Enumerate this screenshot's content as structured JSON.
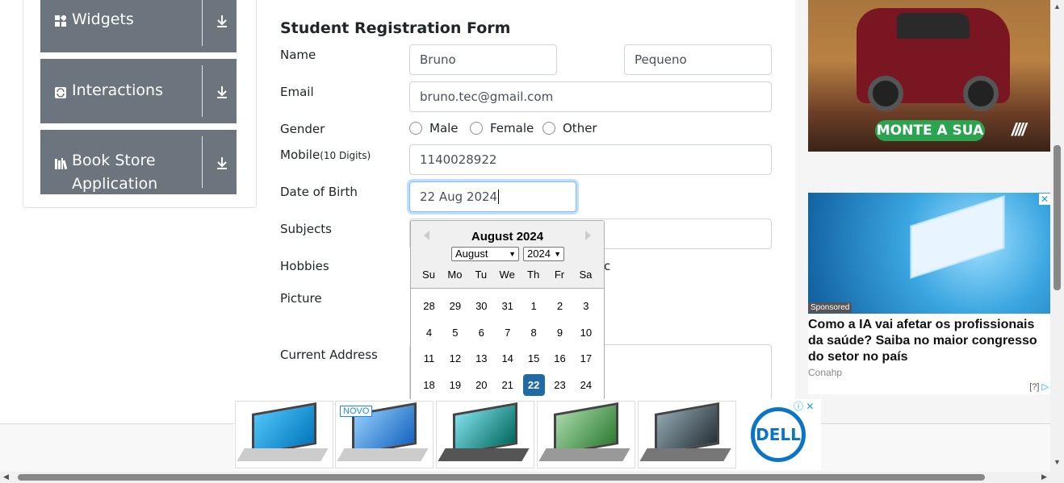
{
  "sidebar": {
    "groups": [
      {
        "label": "Widgets",
        "icon": "widgets-icon"
      },
      {
        "label": "Interactions",
        "icon": "interactions-icon"
      },
      {
        "label": "Book Store\nApplication",
        "label_line1": "Book Store",
        "label_line2": "Application",
        "icon": "books-icon"
      }
    ]
  },
  "form": {
    "title": "Student Registration Form",
    "name_label": "Name",
    "first_name": "Bruno",
    "last_name": "Pequeno",
    "email_label": "Email",
    "email": "bruno.tec@gmail.com",
    "gender_label": "Gender",
    "gender_options": [
      "Male",
      "Female",
      "Other"
    ],
    "mobile_label": "Mobile",
    "mobile_hint": "(10 Digits)",
    "mobile": "1140028922",
    "dob_label": "Date of Birth",
    "dob": "22 Aug 2024",
    "subjects_label": "Subjects",
    "hobbies_label": "Hobbies",
    "hobbies_tail": "c",
    "picture_label": "Picture",
    "address_label": "Current Address"
  },
  "datepicker": {
    "month_title": "August 2024",
    "month_select": "August",
    "year_select": "2024",
    "day_names": [
      "Su",
      "Mo",
      "Tu",
      "We",
      "Th",
      "Fr",
      "Sa"
    ],
    "weeks": [
      [
        "28",
        "29",
        "30",
        "31",
        "1",
        "2",
        "3"
      ],
      [
        "4",
        "5",
        "6",
        "7",
        "8",
        "9",
        "10"
      ],
      [
        "11",
        "12",
        "13",
        "14",
        "15",
        "16",
        "17"
      ],
      [
        "18",
        "19",
        "20",
        "21",
        "22",
        "23",
        "24"
      ]
    ],
    "selected": "22",
    "accent": "#216ba5"
  },
  "ads": {
    "car_cta": "MONTE A SUA",
    "car_mark": "////",
    "tech_badge": "Sponsored",
    "tech_headline": "Como a IA vai afetar os profissionais da saúde? Saiba no maior congresso do setor no país",
    "tech_source": "Conahp",
    "tech_adchoices": "[?]",
    "bottom_badge": "NOVO",
    "bottom_brand": "DELL"
  },
  "colors": {
    "sidebar_bg": "#6c757d",
    "cta_green": "#2aa44f",
    "dell_blue": "#0a74c9"
  }
}
